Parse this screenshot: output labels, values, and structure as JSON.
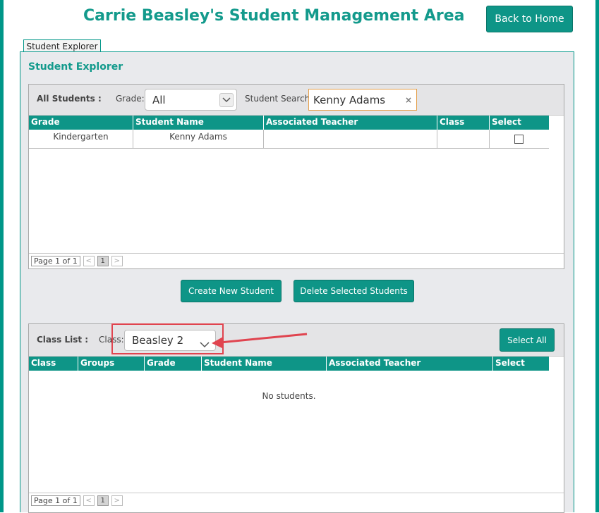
{
  "header": {
    "title": "Carrie Beasley's Student Management Area",
    "back_button": "Back to Home"
  },
  "tab": {
    "label": "Student Explorer"
  },
  "explorer": {
    "title": "Student Explorer",
    "all_students_label": "All Students :",
    "grade_label": "Grade:",
    "grade_value": "All",
    "search_label": "Student Search:",
    "search_value": "Kenny Adams",
    "search_clear": "×",
    "columns": [
      "Grade",
      "Student Name",
      "Associated Teacher",
      "Class",
      "Select"
    ],
    "rows": [
      {
        "grade": "Kindergarten",
        "student_name": "Kenny Adams",
        "teacher": "",
        "class": "",
        "selected": false
      }
    ],
    "pager": {
      "page_text": "Page 1 of 1",
      "prev": "<",
      "current": "1",
      "next": ">"
    }
  },
  "actions": {
    "create_label": "Create New Student",
    "delete_label": "Delete Selected Students"
  },
  "class_list": {
    "label": "Class List :",
    "class_label": "Class:",
    "class_value": "Beasley 2",
    "select_all_label": "Select All",
    "columns": [
      "Class",
      "Groups",
      "Grade",
      "Student Name",
      "Associated Teacher",
      "Select"
    ],
    "empty_text": "No students.",
    "pager": {
      "page_text": "Page 1 of 1",
      "prev": "<",
      "current": "1",
      "next": ">"
    }
  },
  "colors": {
    "accent": "#0e9587",
    "title": "#139a8c",
    "panel_bg": "#e9eaed",
    "annotation": "#e0444f"
  }
}
